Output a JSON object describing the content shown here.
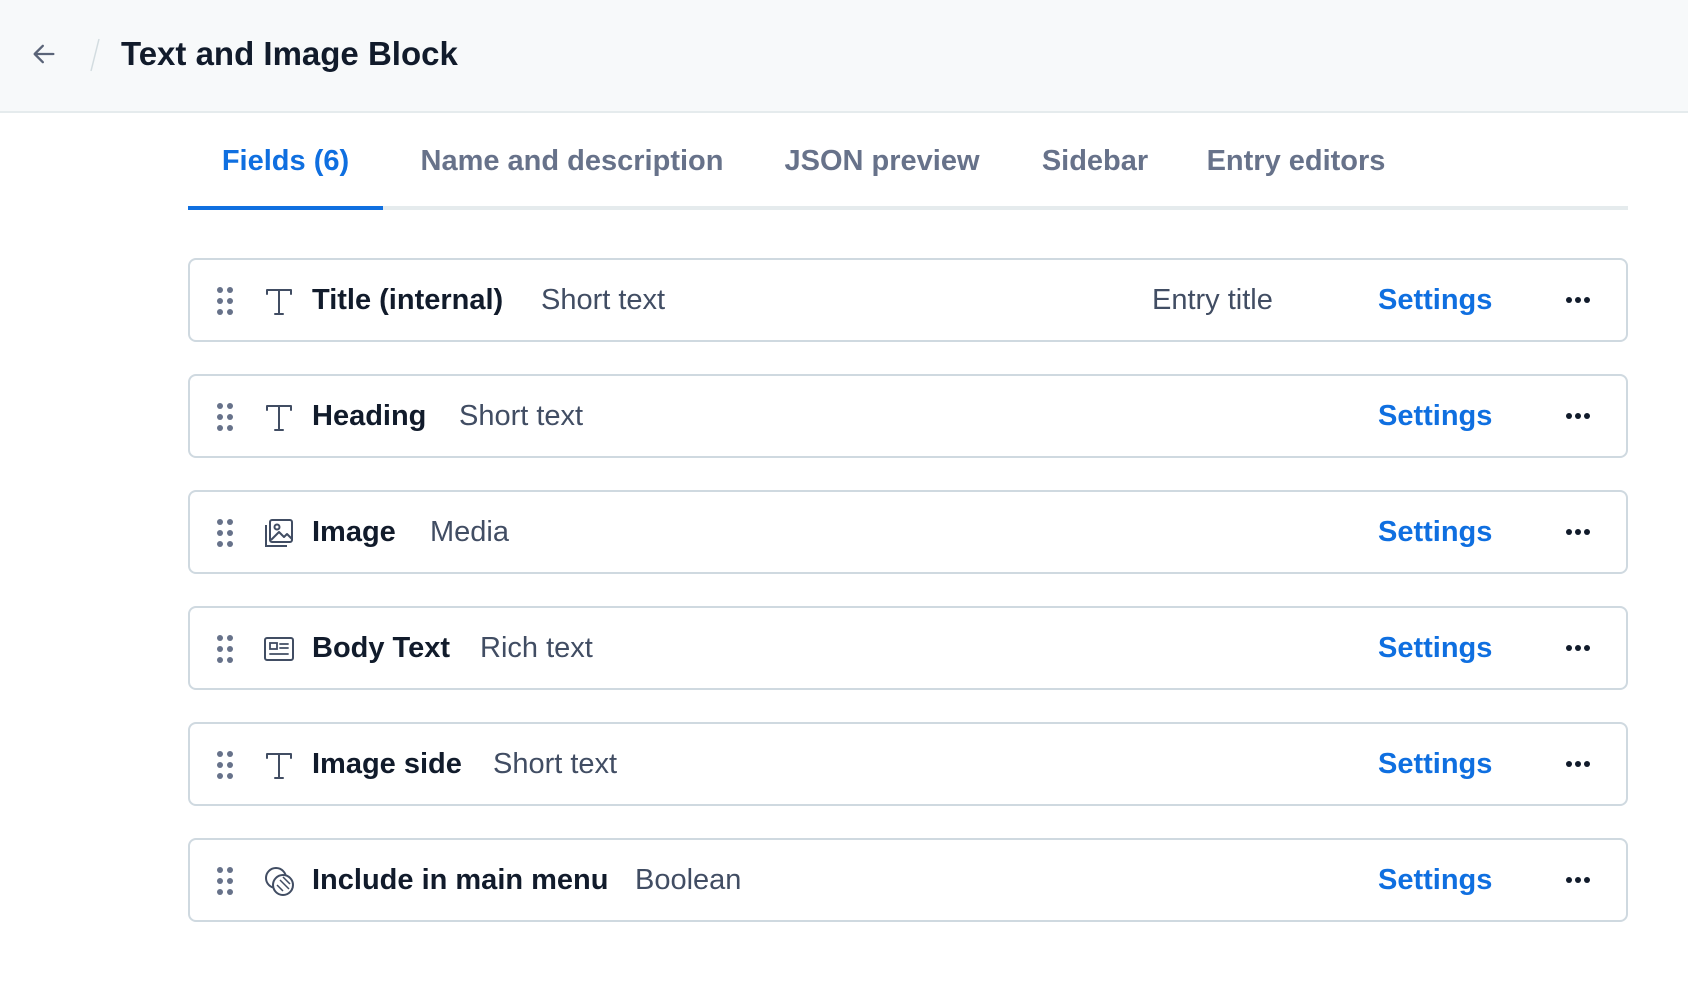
{
  "header": {
    "title": "Text and Image Block",
    "back_icon": "arrow-left-icon"
  },
  "tabs": [
    {
      "label": "Fields (6)",
      "active": true
    },
    {
      "label": "Name and description",
      "active": false
    },
    {
      "label": "JSON preview",
      "active": false
    },
    {
      "label": "Sidebar",
      "active": false
    },
    {
      "label": "Entry editors",
      "active": false
    }
  ],
  "fields": [
    {
      "name": "Title (internal)",
      "type": "Short text",
      "icon": "text-icon",
      "badge": "Entry title",
      "settings_label": "Settings"
    },
    {
      "name": "Heading",
      "type": "Short text",
      "icon": "text-icon",
      "settings_label": "Settings"
    },
    {
      "name": "Image",
      "type": "Media",
      "icon": "media-icon",
      "settings_label": "Settings"
    },
    {
      "name": "Body Text",
      "type": "Rich text",
      "icon": "rich-text-icon",
      "settings_label": "Settings"
    },
    {
      "name": "Image side",
      "type": "Short text",
      "icon": "text-icon",
      "settings_label": "Settings"
    },
    {
      "name": "Include in main menu",
      "type": "Boolean",
      "icon": "boolean-icon",
      "settings_label": "Settings"
    }
  ],
  "colors": {
    "accent": "#0f6fe0",
    "text_primary": "#111b2b",
    "text_secondary": "#414d63",
    "border": "#cfd9e0",
    "header_bg": "#f7f9fa"
  }
}
